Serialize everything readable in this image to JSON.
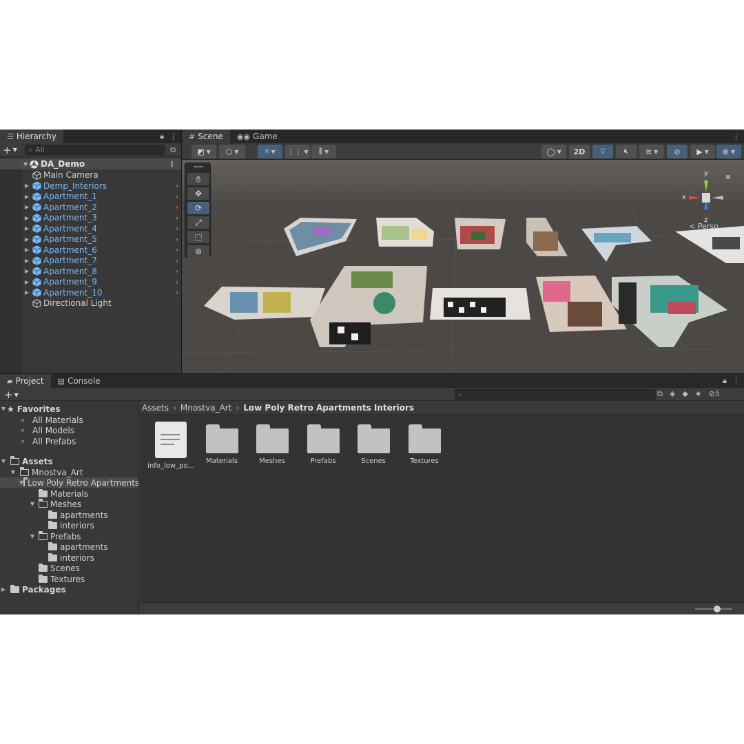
{
  "hierarchy": {
    "tab_label": "Hierarchy",
    "search_placeholder": "All",
    "scene_name": "DA_Demo",
    "items": [
      {
        "label": "Main Camera",
        "prefab": false,
        "expandable": false
      },
      {
        "label": "Demp_Interiors",
        "prefab": true,
        "expandable": true
      },
      {
        "label": "Apartment_1",
        "prefab": true,
        "expandable": true
      },
      {
        "label": "Apartment_2",
        "prefab": true,
        "expandable": true
      },
      {
        "label": "Apartment_3",
        "prefab": true,
        "expandable": true
      },
      {
        "label": "Apartment_4",
        "prefab": true,
        "expandable": true
      },
      {
        "label": "Apartment_5",
        "prefab": true,
        "expandable": true
      },
      {
        "label": "Apartment_6",
        "prefab": true,
        "expandable": true
      },
      {
        "label": "Apartment_7",
        "prefab": true,
        "expandable": true
      },
      {
        "label": "Apartment_8",
        "prefab": true,
        "expandable": true
      },
      {
        "label": "Apartment_9",
        "prefab": true,
        "expandable": true
      },
      {
        "label": "Apartment_10",
        "prefab": true,
        "expandable": true
      },
      {
        "label": "Directional Light",
        "prefab": false,
        "expandable": false
      }
    ]
  },
  "scene_view": {
    "tabs": [
      {
        "label": "Scene",
        "active": true
      },
      {
        "label": "Game",
        "active": false
      }
    ],
    "toolbar": {
      "mode_2d_label": "2D"
    },
    "gizmo": {
      "x_label": "x",
      "y_label": "y",
      "z_label": "z",
      "projection_label": "< Persp"
    },
    "tools": [
      "hand-tool",
      "move-tool",
      "rotate-tool",
      "scale-tool",
      "rect-tool",
      "transform-tool"
    ],
    "active_tool": "rotate-tool"
  },
  "project": {
    "tabs": [
      {
        "label": "Project",
        "active": true
      },
      {
        "label": "Console",
        "active": false
      }
    ],
    "hidden_count": "5",
    "tree": {
      "favorites_label": "Favorites",
      "favorites": [
        "All Materials",
        "All Models",
        "All Prefabs"
      ],
      "assets_label": "Assets",
      "mnostva_label": "Mnostva_Art",
      "low_poly_label": "Low Poly Retro Apartments Interiors",
      "materials_label": "Materials",
      "meshes_label": "Meshes",
      "meshes_children": [
        "apartments",
        "interiors"
      ],
      "prefabs_label": "Prefabs",
      "prefabs_children": [
        "apartments",
        "interiors"
      ],
      "scenes_label": "Scenes",
      "textures_label": "Textures",
      "packages_label": "Packages"
    },
    "breadcrumb": [
      "Assets",
      "Mnostva_Art",
      "Low Poly Retro Apartments Interiors"
    ],
    "assets": [
      {
        "label": "info_low_po...",
        "type": "document"
      },
      {
        "label": "Materials",
        "type": "folder"
      },
      {
        "label": "Meshes",
        "type": "folder"
      },
      {
        "label": "Prefabs",
        "type": "folder"
      },
      {
        "label": "Scenes",
        "type": "folder"
      },
      {
        "label": "Textures",
        "type": "folder"
      }
    ],
    "zoom_level": 0.6
  },
  "colors": {
    "prefab_blue": "#7ab8f5",
    "accent_active": "#46607c",
    "panel_bg": "#383838",
    "axis_x": "#e04a3a",
    "axis_y": "#8ed04a",
    "axis_z": "#3a7fe0"
  }
}
